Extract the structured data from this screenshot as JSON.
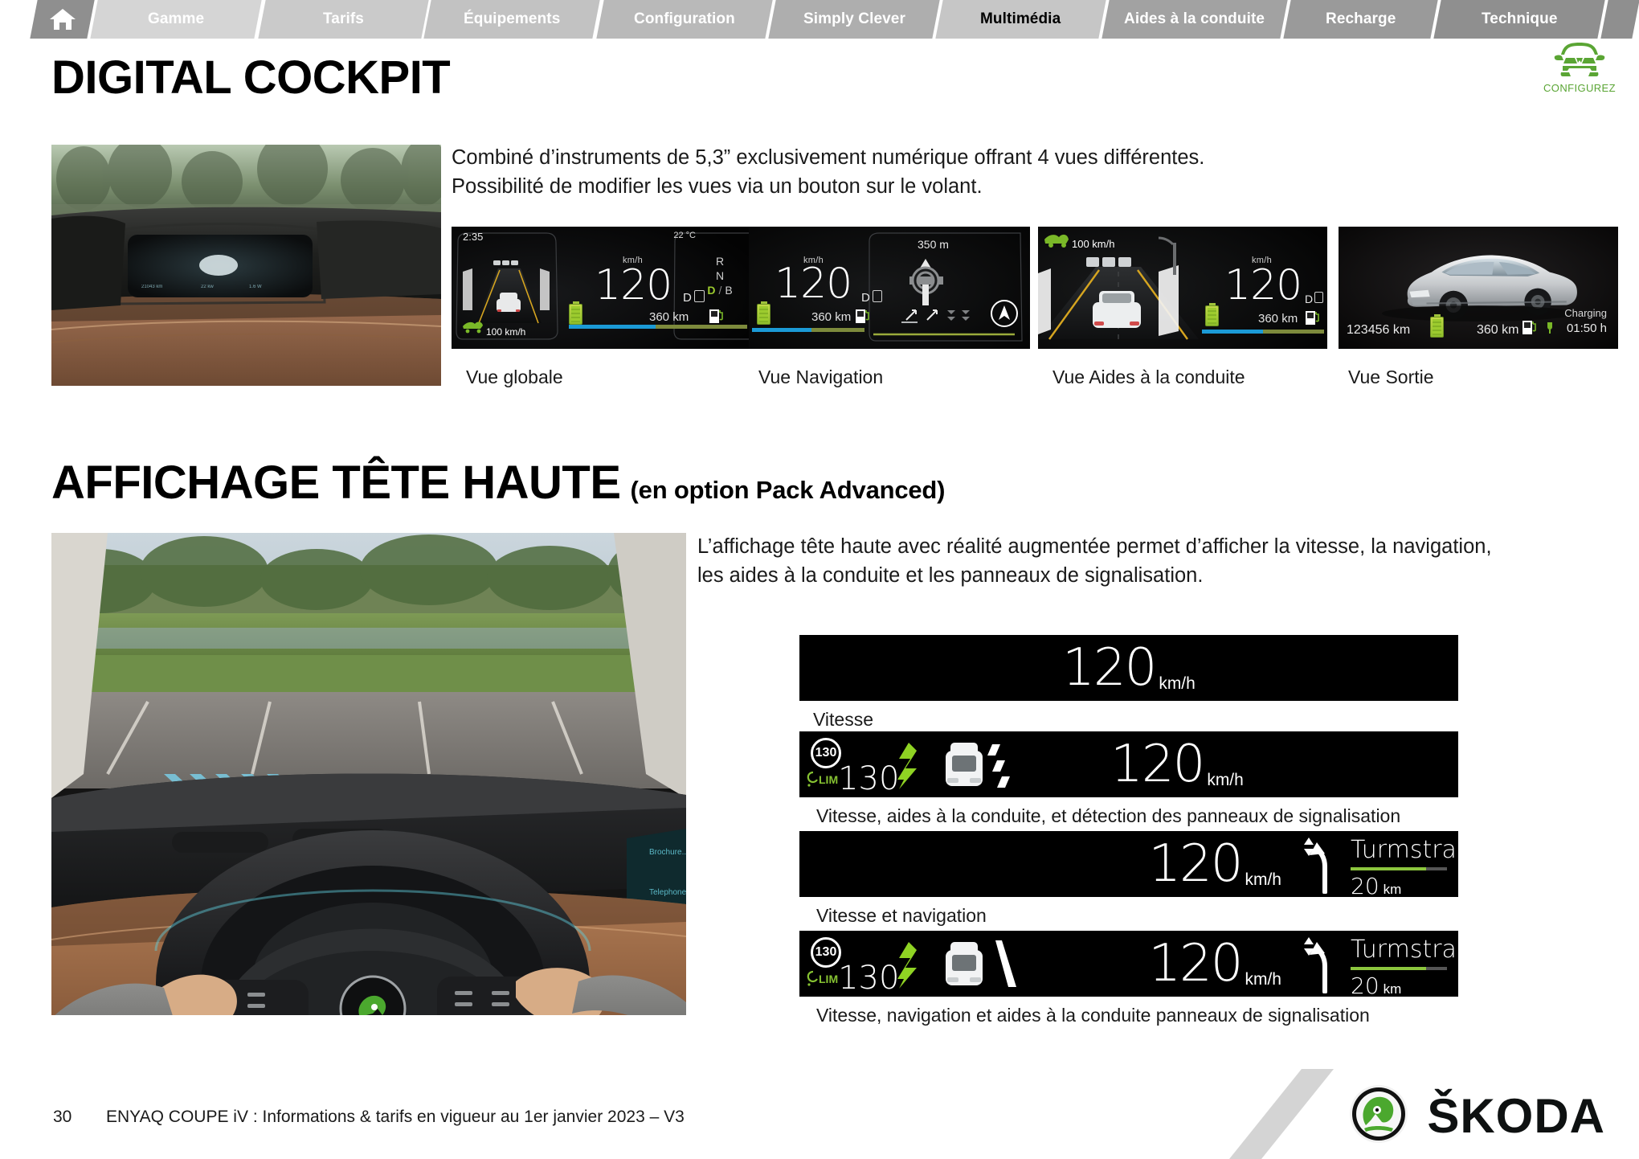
{
  "nav": {
    "home_icon": "home-icon",
    "tabs": [
      {
        "label": "Gamme",
        "active": false
      },
      {
        "label": "Tarifs",
        "active": false
      },
      {
        "label": "Équipements",
        "active": false
      },
      {
        "label": "Configuration",
        "active": false
      },
      {
        "label": "Simply Clever",
        "active": false
      },
      {
        "label": "Multimédia",
        "active": true
      },
      {
        "label": "Aides à la conduite",
        "active": false
      },
      {
        "label": "Recharge",
        "active": false
      },
      {
        "label": "Technique",
        "active": false
      }
    ]
  },
  "configurez": {
    "label": "CONFIGUREZ",
    "icon": "car-front-icon",
    "color": "#5aa534"
  },
  "section_cockpit": {
    "title": "DIGITAL COCKPIT",
    "description_line1": "Combiné d’instruments de 5,3” exclusivement numérique offrant 4 vues différentes.",
    "description_line2": "Possibilité de modifier les vues via un bouton sur le volant.",
    "photo_alt": "digital-cockpit-interior-photo",
    "clusters": [
      {
        "caption": "Vue globale",
        "time": "2:35",
        "temperature": "22 °C",
        "unit": "km/h",
        "speed": "120",
        "gear_indicator": "D",
        "assist_speed": "100 km/h",
        "range": "360 km",
        "gears": [
          "R",
          "N",
          "D",
          "B"
        ],
        "gear_selected": "D"
      },
      {
        "caption": "Vue Navigation",
        "unit": "km/h",
        "speed": "120",
        "gear_indicator": "D",
        "nav_distance": "350 m",
        "range": "360 km"
      },
      {
        "caption": "Vue Aides à la conduite",
        "unit": "km/h",
        "speed": "120",
        "gear_indicator": "D",
        "assist_speed": "100 km/h",
        "range": "360 km"
      },
      {
        "caption": "Vue Sortie",
        "odometer": "123456 km",
        "range": "360 km",
        "charging_label": "Charging",
        "charging_time": "01:50 h"
      }
    ]
  },
  "section_hud": {
    "title": "AFFICHAGE TÊTE HAUTE",
    "title_suffix": "(en option Pack Advanced)",
    "description_line1": "L’affichage tête haute avec réalité augmentée permet d’afficher la vitesse, la navigation,",
    "description_line2": "les aides à la conduite et les panneaux de signalisation.",
    "photo_alt": "head-up-display-steering-wheel-photo",
    "strips": [
      {
        "caption": "Vitesse",
        "speed": "120",
        "unit": "km/h"
      },
      {
        "caption": "Vitesse, aides à la conduite, et détection des panneaux de signalisation",
        "speed": "120",
        "unit": "km/h",
        "sign_limit": "130",
        "lim_tag": "LIM",
        "lim_value": "130"
      },
      {
        "caption": "Vitesse et navigation",
        "speed": "120",
        "unit": "km/h",
        "street": "Turmstraße",
        "street_distance": "20",
        "street_distance_unit": "km"
      },
      {
        "caption": "Vitesse, navigation et aides à la conduite panneaux de signalisation",
        "speed": "120",
        "unit": "km/h",
        "sign_limit": "130",
        "lim_tag": "LIM",
        "lim_value": "130",
        "street": "Turmstraße",
        "street_distance": "20",
        "street_distance_unit": "km"
      }
    ]
  },
  "footer": {
    "page_number": "30",
    "text": "ENYAQ COUPE iV : Informations & tarifs en vigueur au 1er janvier 2023 – V3",
    "brand": "ŠKODA",
    "brand_icon": "skoda-winged-arrow-logo"
  }
}
